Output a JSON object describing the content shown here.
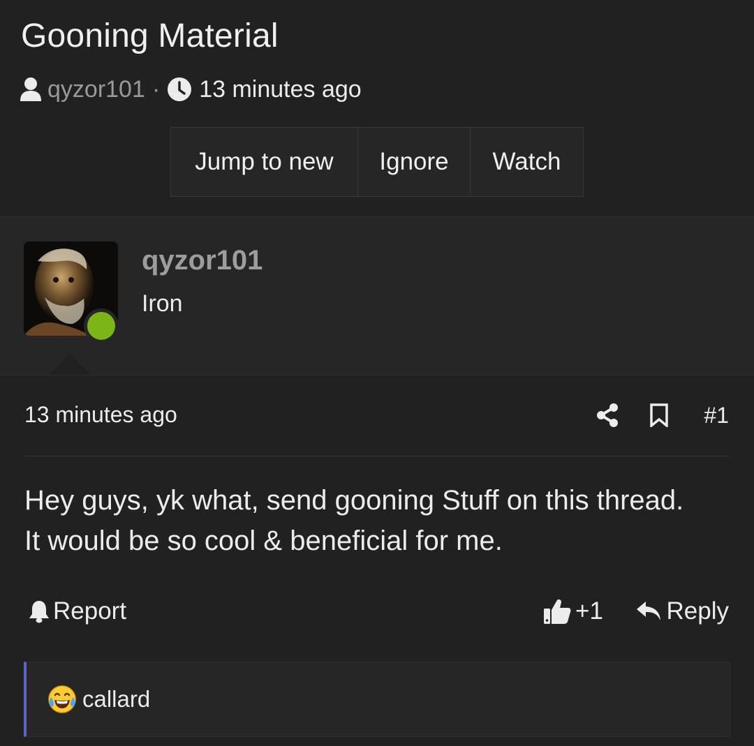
{
  "thread": {
    "title": "Gooning Material",
    "author": "qyzor101",
    "separator": "·",
    "time": "13 minutes ago",
    "icons": {
      "author": "user-icon",
      "time": "clock-icon"
    }
  },
  "thread_buttons": {
    "jump_to_new": "Jump to new",
    "ignore": "Ignore",
    "watch": "Watch"
  },
  "user_card": {
    "username": "qyzor101",
    "title": "Iron",
    "status": "online",
    "status_color": "#7cb518"
  },
  "post": {
    "time": "13 minutes ago",
    "number": "#1",
    "body_line1": "Hey guys, yk what, send gooning Stuff on this thread.",
    "body_line2": "It would be so cool & beneficial for me.",
    "report_label": "Report",
    "like_count": "+1",
    "reply_label": "Reply",
    "icons": {
      "share": "share-icon",
      "bookmark": "bookmark-icon",
      "report": "bell-icon",
      "like": "thumbs-up-icon",
      "reply": "reply-icon"
    }
  },
  "reactions": {
    "emoji": "laughing-crying-emoji",
    "users": "callard",
    "accent_color": "#5b63c9"
  }
}
